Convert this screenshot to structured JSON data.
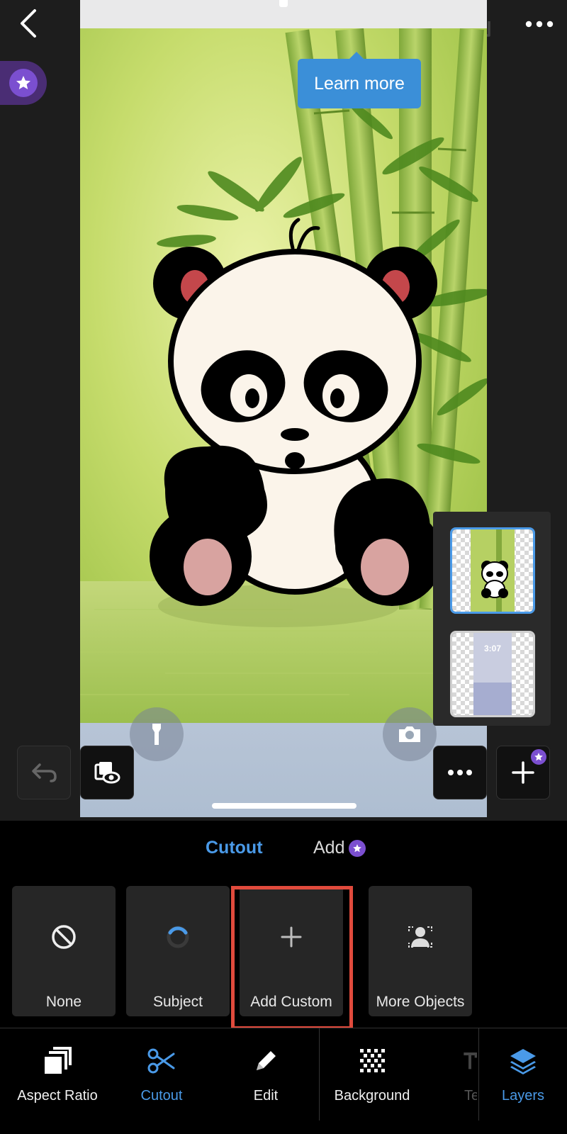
{
  "tooltip": {
    "text": "Learn more"
  },
  "layers": {
    "thumb2_time": "3:07"
  },
  "panel": {
    "tabs": {
      "cutout": "Cutout",
      "add": "Add"
    },
    "tiles": {
      "none": "None",
      "subject": "Subject",
      "add_custom": "Add Custom",
      "more_objects": "More Objects"
    }
  },
  "toolbar": {
    "aspect_ratio": "Aspect Ratio",
    "cutout": "Cutout",
    "edit": "Edit",
    "background": "Background",
    "text": "Te",
    "layers": "Layers"
  },
  "colors": {
    "accent": "#4a9ae8",
    "premium": "#7b4fd0",
    "highlight": "#e04a3c"
  }
}
